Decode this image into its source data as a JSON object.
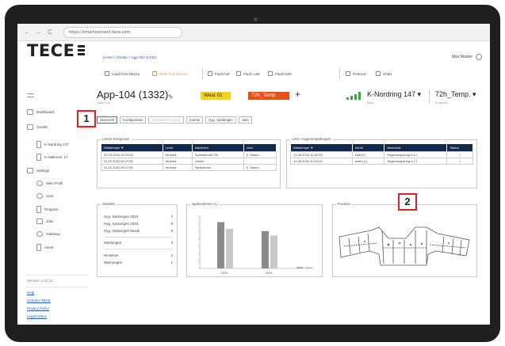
{
  "browser": {
    "back": "←",
    "forward": "→",
    "reload": "C",
    "url": "https://smartconnect.tece.com"
  },
  "brand": {
    "logo": "TECE"
  },
  "sidebar": {
    "dashboard": "Dashboard",
    "devices": "Geräte",
    "device_items": [
      "K-Nordring 147",
      "K-Hallenstr. 17"
    ],
    "settings": "Settings",
    "settings_items": [
      "Mein Profil",
      "User",
      "Program",
      "Jobs",
      "Gateway",
      "Asset"
    ],
    "version": "Version: 1.01.12",
    "links": [
      "Help",
      "Connect TECE",
      "Privacy Policy",
      "Legal Notice"
    ]
  },
  "header": {
    "breadcrumb": "Home > Geräte > App-104 (1332)",
    "user": "Max Muster"
  },
  "toolbar": {
    "load_from_device": "Load from Device",
    "write_to_device": "Write from Device",
    "flush_hot": "Flush hot",
    "flush_cold": "Flush cold",
    "flush_both": "Flush both",
    "protocol": "Protocol",
    "chart": "Chart"
  },
  "device": {
    "title": "App-104 (1332)",
    "subtitle": "Gäste Kuhl",
    "badge_location": "West 01",
    "badge_temp": "72h_Temp.",
    "site": "K-Nordring 147 ▾",
    "site_sub": "Basis",
    "mode": "72h_Temp. ▾",
    "mode_sub": "Programm",
    "colors": {
      "badge_yellow": "#f5d41e",
      "badge_orange": "#e8501a",
      "signal": "#2dad3b",
      "header": "#13294b",
      "callout": "#e21e26"
    }
  },
  "tabs": [
    "Übersicht",
    "Konfiguration",
    "Geplante Prozesse",
    "Events",
    "Hyg. Spülungen",
    "Jobs"
  ],
  "events": {
    "title": "Letzte Ereignisse",
    "columns": [
      "Zeitstempel ▼",
      "Level",
      "Nachricht",
      "User"
    ],
    "rows": [
      [
        "02.05.2024 10:23:03",
        "Hinweis",
        "Spülintervall 72h",
        "K. Mauer"
      ],
      [
        "01.02.2023 08:27:00",
        "Hinweis",
        "Online",
        ""
      ],
      [
        "01.02.2023 08:17:00",
        "Hinweis",
        "Werkabnen",
        "K. Mauer"
      ]
    ]
  },
  "flushes": {
    "title": "Letzt. Hygienespülungen",
    "columns": [
      "Zeitstempel ▼",
      "Ventil",
      "Nachricht",
      "Status"
    ],
    "rows": [
      [
        "12.08.2024 10:32:00",
        "kalt (K)",
        "Hygienespülung 5.6 l",
        "✓"
      ],
      [
        "12.08.2024 10:15:00",
        "warm (L)",
        "Hygienespülung 4.2 l",
        "✓"
      ]
    ]
  },
  "statistics": {
    "title": "Statistik",
    "rows": [
      {
        "label": "Hyg. Spülungen 2024",
        "value": "7"
      },
      {
        "label": "Hyg. Spülungen 2023",
        "value": "6"
      },
      {
        "label": "Hyg. Spülungen Musik",
        "value": "6"
      },
      {
        "label": "Meldungen",
        "value": "3"
      },
      {
        "label": "Hinweise",
        "value": "2"
      },
      {
        "label": "Warnungen",
        "value": "1"
      }
    ]
  },
  "volume": {
    "title": "Spülvolumen (L)"
  },
  "chart_data": {
    "type": "bar",
    "title": "Spülvolumen (L)",
    "categories": [
      "2023",
      "2024"
    ],
    "series": [
      {
        "values": [
          62,
          50
        ]
      },
      {
        "values": [
          53,
          44
        ]
      }
    ],
    "ylim": [
      0,
      70
    ]
  },
  "position": {
    "title": "Position"
  },
  "callouts": [
    "1",
    "2"
  ]
}
